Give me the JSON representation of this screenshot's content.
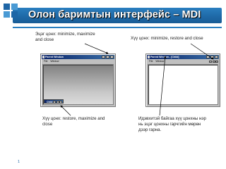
{
  "slide": {
    "title": "Олон баримтын интерфейс – MDI",
    "page_number": "1"
  },
  "notes": {
    "top_left": "Эцэг цонх: minimize, maximize and close",
    "top_right": "Хүү цонх: minimize, restore and close",
    "bottom_left": "Хүү цонх: restore, maximize and close",
    "bottom_right": "Идэвхитэй байгаа хүү цонхны нэр нь эцэг цонхны гарчгийн мөрөн дээр гарна."
  },
  "left_window": {
    "title": "Parent Window",
    "menu": [
      "File",
      "Window"
    ],
    "minimized_child_title": "Child"
  },
  "right_window": {
    "title": "Parent Window - [Child]",
    "menu": [
      "File",
      "Window"
    ]
  },
  "colors": {
    "banner": "#1f6aa8",
    "title_text": "#ffffff",
    "window_face": "#c0c0c0",
    "titlebar_start": "#0a246a",
    "titlebar_end": "#3a6ea5"
  }
}
